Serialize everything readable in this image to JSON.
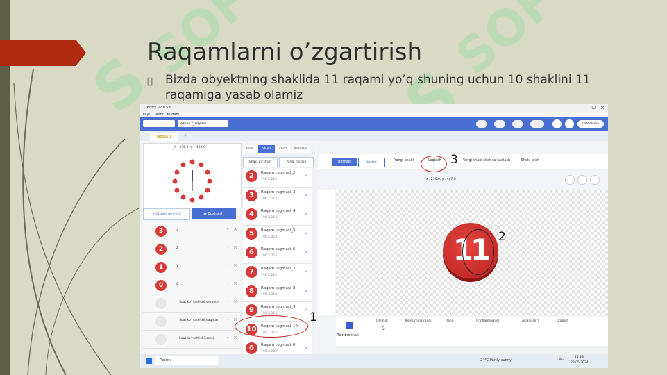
{
  "slide": {
    "title": "Raqamlarni o’zgartirish",
    "bullet_glyph": "",
    "bullet": "Bizda obyektning shaklida 11 raqami yo’q shuning uchun 10 shaklini 11 raqamiga yasab olamiz"
  },
  "app": {
    "window_title": "Entry v2.0.53",
    "menu": [
      "Fayl",
      "Tahrir",
      "Yordam"
    ],
    "project_name": "240522_Loyiha",
    "tab_label": "Tablisa 1",
    "coords_left": "X : 236.6, Y : -162.0",
    "coords_right": "x : 230.0, y : 467.0",
    "user_label": "ODAshuha",
    "add_object": "+ Obyekt qo'shish",
    "run_button": "▶ Boshlash",
    "mid_tabs": [
      "Blok",
      "Shakl",
      "Ovoz",
      "Xossalar"
    ],
    "mid_buttons": [
      "Shakl qo'shish",
      "Yangi chizish"
    ],
    "editor_modes": [
      "Bitmap",
      "Vector"
    ],
    "editor_actions": [
      "Yangi shakl",
      "Saqlash",
      "Yangi shakl sifatida saqlash",
      "Shakl olish"
    ],
    "shapes": [
      {
        "num": "2",
        "name": "Raqam tugmasi_2",
        "size": "190 X 214"
      },
      {
        "num": "3",
        "name": "Raqam tugmasi_3",
        "size": "190 X 214"
      },
      {
        "num": "4",
        "name": "Raqam tugmasi_4",
        "size": "190 X 214"
      },
      {
        "num": "5",
        "name": "Raqam tugmasi_5",
        "size": "190 X 214"
      },
      {
        "num": "6",
        "name": "Raqam tugmasi_6",
        "size": "190 X 214"
      },
      {
        "num": "7",
        "name": "Raqam tugmasi_7",
        "size": "190 X 214"
      },
      {
        "num": "8",
        "name": "Raqam tugmasi_8",
        "size": "190 X 214"
      },
      {
        "num": "9",
        "name": "Raqam tugmasi_9",
        "size": "190 X 214"
      },
      {
        "num": "10",
        "name": "Raqam tugmasi_10",
        "size": "190 X 214"
      },
      {
        "num": "0",
        "name": "Raqam tugmasi_0",
        "size": "190 X 214"
      }
    ],
    "objects": [
      {
        "num": "3",
        "label": "3"
      },
      {
        "num": "2",
        "label": "2"
      },
      {
        "num": "1",
        "label": "1"
      },
      {
        "num": "0",
        "label": "0"
      },
      {
        "num": "",
        "label": "Soat ko'rsatkichi(sekund)"
      },
      {
        "num": "",
        "label": "Soat ko'rsatkichi(daqiqa)"
      },
      {
        "num": "",
        "label": "Soat ko'rsatkichi(soat)"
      }
    ],
    "big_number": "11",
    "props": {
      "shape_label": "To'rtburchak",
      "thickness_label": "Qalinlik",
      "thickness_value": "5",
      "outline_label": "Konturning rangi",
      "fill_label": "Rang",
      "size_label": "O'lcham(piksel)",
      "angle_label": "Aylanish(°)",
      "flip_label": "O'girish"
    },
    "taskbar": {
      "search": "Поиск",
      "weather": "24°C Partly sunny",
      "lang": "ENG",
      "time": "14:28",
      "date": "23.05.2024"
    }
  },
  "annotations": [
    "1",
    "2",
    "3"
  ],
  "watermark": "SOF"
}
